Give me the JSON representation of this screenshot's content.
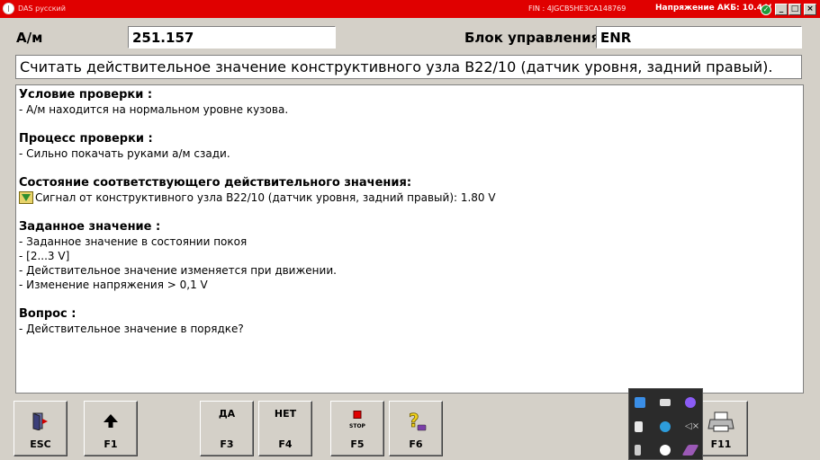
{
  "window": {
    "title": "DAS русский",
    "fin": "FIN : 4JGCB5HE3CA148769",
    "battery": "Напряжение АКБ: 10.4 V",
    "buttons": {
      "minimize": "_",
      "maximize": "□",
      "close": "×"
    }
  },
  "header": {
    "vehicle_label": "А/м",
    "vehicle_value": "251.157",
    "control_unit_label": "Блок управления",
    "control_unit_value": "ENR"
  },
  "heading": "Считать действительное значение конструктивного узла B22/10 (датчик уровня, задний правый).",
  "content": {
    "condition_title": "Условие проверки :",
    "condition_text": "- А/м находится на нормальном уровне кузова.",
    "process_title": "Процесс проверки :",
    "process_text": "- Сильно покачать руками а/м сзади.",
    "state_title": "Состояние соответствующего действительного значения:",
    "state_text": "Сигнал от конструктивного узла B22/10 (датчик уровня, задний правый): 1.80 V",
    "setpoint_title": "Заданное значение :",
    "setpoint_lines": [
      "- Заданное значение в состоянии покоя",
      "- [2...3 V]",
      "- Действительное значение изменяется при движении.",
      "- Изменение напряжения > 0,1 V"
    ],
    "question_title": "Вопрос :",
    "question_text": "- Действительное значение в порядке?"
  },
  "keys": {
    "esc": "ESC",
    "f1": "F1",
    "f3_top": "ДА",
    "f3": "F3",
    "f4_top": "НЕТ",
    "f4": "F4",
    "f5_top": "STOP",
    "f5": "F5",
    "f6": "F6",
    "f11": "F11"
  },
  "icons": {
    "esc": "exit-door-icon",
    "f1": "arrow-up-icon",
    "f5": "stop-icon",
    "f6": "help-icon",
    "f11": "printer-icon"
  },
  "colors": {
    "title_bar": "#e00000",
    "background": "#d4d0c8",
    "ok_status": "#1f9a3a"
  }
}
